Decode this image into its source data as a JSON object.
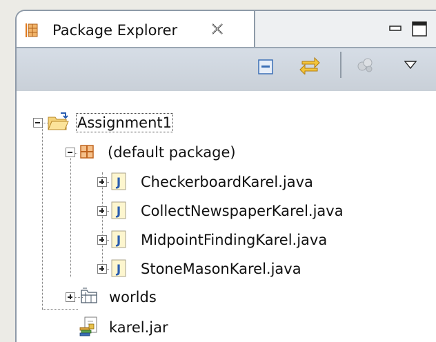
{
  "view": {
    "tab_title": "Package Explorer",
    "close_icon": "close-x-icon",
    "minimize_icon": "minimize-icon",
    "maximize_icon": "maximize-icon"
  },
  "toolbar": {
    "collapse_all_icon": "collapse-all-icon",
    "link_with_editor_icon": "link-with-editor-icon",
    "filter_icon": "filter-icon",
    "view_menu_icon": "view-menu-chevron-icon"
  },
  "tree": {
    "project": {
      "label": "Assignment1",
      "expanded": true,
      "icon": "java-project-icon"
    },
    "package": {
      "label": "(default package)",
      "expanded": true,
      "icon": "package-icon"
    },
    "files": [
      {
        "label": "CheckerboardKarel.java",
        "icon": "java-file-icon"
      },
      {
        "label": "CollectNewspaperKarel.java",
        "icon": "java-file-icon"
      },
      {
        "label": "MidpointFindingKarel.java",
        "icon": "java-file-icon"
      },
      {
        "label": "StoneMasonKarel.java",
        "icon": "java-file-icon"
      }
    ],
    "folder": {
      "label": "worlds",
      "expanded": false,
      "icon": "folder-icon"
    },
    "jar": {
      "label": "karel.jar",
      "icon": "jar-file-icon"
    }
  },
  "colors": {
    "accent_orange": "#e07a1f",
    "java_icon_blue": "#2a5db0",
    "toolbar_icon_blue": "#3b6fb6"
  }
}
